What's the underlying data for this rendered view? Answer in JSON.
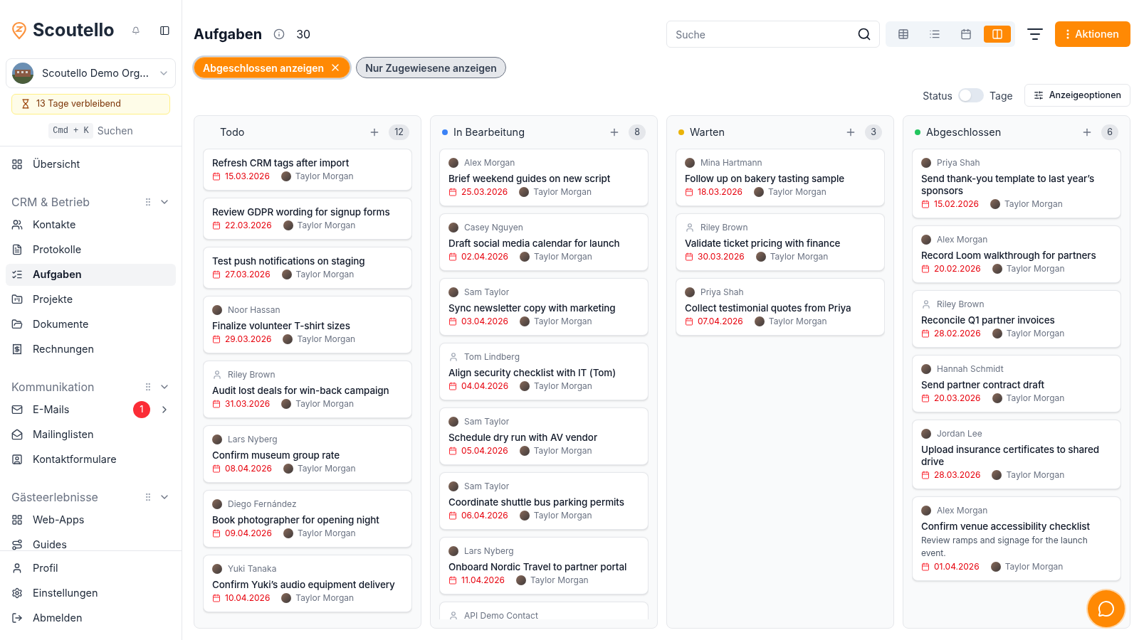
{
  "sidebar": {
    "brand": "Scoutello",
    "org": {
      "name": "Scoutello Demo Org..."
    },
    "trial": "13 Tage verbleibend",
    "shortcut": {
      "keys": "Cmd + K",
      "label": "Suchen"
    },
    "top_items": [
      {
        "label": "Übersicht",
        "selected": false
      }
    ],
    "sections": [
      {
        "title": "CRM & Betrieb",
        "items": [
          {
            "label": "Kontakte",
            "selected": false
          },
          {
            "label": "Protokolle",
            "selected": false
          },
          {
            "label": "Aufgaben",
            "selected": true
          },
          {
            "label": "Projekte",
            "selected": false
          },
          {
            "label": "Dokumente",
            "selected": false
          },
          {
            "label": "Rechnungen",
            "selected": false
          }
        ]
      },
      {
        "title": "Kommunikation",
        "items": [
          {
            "label": "E-Mails",
            "selected": false,
            "badge": "1"
          },
          {
            "label": "Mailinglisten",
            "selected": false
          },
          {
            "label": "Kontaktformulare",
            "selected": false
          }
        ]
      },
      {
        "title": "Gästeerlebnisse",
        "items": [
          {
            "label": "Web-Apps",
            "selected": false
          },
          {
            "label": "Guides",
            "selected": false
          }
        ]
      }
    ],
    "bottom_items": [
      {
        "label": "Profil"
      },
      {
        "label": "Einstellungen"
      },
      {
        "label": "Abmelden"
      }
    ]
  },
  "header": {
    "title": "Aufgaben",
    "count": "30",
    "search": {
      "placeholder": "Suche"
    },
    "views": [
      {
        "kind": "table",
        "selected": false
      },
      {
        "kind": "list",
        "selected": false
      },
      {
        "kind": "calendar",
        "selected": false
      },
      {
        "kind": "board",
        "selected": true
      }
    ],
    "actions_button": "Aktionen"
  },
  "filters": [
    {
      "label": "Abgeschlossen anzeigen",
      "selected": true
    },
    {
      "label": "Nur Zugewiesene anzeigen",
      "selected": false
    }
  ],
  "display": {
    "left_label": "Status",
    "right_label": "Tage",
    "on": false,
    "options_button": "Anzeigeoptionen"
  },
  "columns": [
    {
      "title": "Todo",
      "count": "12",
      "cards": [
        {
          "title": "Refresh CRM tags after import",
          "date": "15.03.2026",
          "assignee": "Taylor Morgan"
        },
        {
          "title": "Review GDPR wording for signup forms",
          "date": "22.03.2026",
          "assignee": "Taylor Morgan"
        },
        {
          "title": "Test push notifications on staging",
          "date": "27.03.2026",
          "assignee": "Taylor Morgan"
        },
        {
          "contact": {
            "name": "Noor Hassan"
          },
          "title": "Finalize volunteer T-shirt sizes",
          "date": "29.03.2026",
          "assignee": "Taylor Morgan"
        },
        {
          "contact": {
            "name": "Riley Brown",
            "kind": "generic"
          },
          "title": "Audit lost deals for win-back campaign",
          "date": "31.03.2026",
          "assignee": "Taylor Morgan"
        },
        {
          "contact": {
            "name": "Lars Nyberg"
          },
          "title": "Confirm museum group rate",
          "date": "08.04.2026",
          "assignee": "Taylor Morgan"
        },
        {
          "contact": {
            "name": "Diego Fernández"
          },
          "title": "Book photographer for opening night",
          "date": "09.04.2026",
          "assignee": "Taylor Morgan"
        },
        {
          "contact": {
            "name": "Yuki Tanaka"
          },
          "title": "Confirm Yuki’s audio equipment delivery",
          "date": "10.04.2026",
          "assignee": "Taylor Morgan"
        }
      ]
    },
    {
      "title": "In Bearbeitung",
      "color": "#3b82f6",
      "count": "8",
      "cards": [
        {
          "contact": {
            "name": "Alex Morgan"
          },
          "title": "Brief weekend guides on new script",
          "date": "25.03.2026",
          "assignee": "Taylor Morgan"
        },
        {
          "contact": {
            "name": "Casey Nguyen"
          },
          "title": "Draft social media calendar for launch",
          "date": "02.04.2026",
          "assignee": "Taylor Morgan"
        },
        {
          "contact": {
            "name": "Sam Taylor"
          },
          "title": "Sync newsletter copy with marketing",
          "date": "03.04.2026",
          "assignee": "Taylor Morgan"
        },
        {
          "contact": {
            "name": "Tom Lindberg",
            "kind": "generic"
          },
          "title": "Align security checklist with IT (Tom)",
          "date": "04.04.2026",
          "assignee": "Taylor Morgan"
        },
        {
          "contact": {
            "name": "Sam Taylor"
          },
          "title": "Schedule dry run with AV vendor",
          "date": "05.04.2026",
          "assignee": "Taylor Morgan"
        },
        {
          "contact": {
            "name": "Sam Taylor"
          },
          "title": "Coordinate shuttle bus parking permits",
          "date": "06.04.2026",
          "assignee": "Taylor Morgan"
        },
        {
          "contact": {
            "name": "Lars Nyberg"
          },
          "title": "Onboard Nordic Travel to partner portal",
          "date": "11.04.2026",
          "assignee": "Taylor Morgan"
        },
        {
          "contact": {
            "name": "API Demo Contact",
            "kind": "generic"
          }
        }
      ]
    },
    {
      "title": "Warten",
      "color": "#eab308",
      "count": "3",
      "cards": [
        {
          "contact": {
            "name": "Mina Hartmann"
          },
          "title": "Follow up on bakery tasting sample",
          "date": "18.03.2026",
          "assignee": "Taylor Morgan"
        },
        {
          "contact": {
            "name": "Riley Brown",
            "kind": "generic"
          },
          "title": "Validate ticket pricing with finance",
          "date": "30.03.2026",
          "assignee": "Taylor Morgan"
        },
        {
          "contact": {
            "name": "Priya Shah"
          },
          "title": "Collect testimonial quotes from Priya",
          "date": "07.04.2026",
          "assignee": "Taylor Morgan"
        }
      ]
    },
    {
      "title": "Abgeschlossen",
      "color": "#22c55e",
      "count": "6",
      "cards": [
        {
          "contact": {
            "name": "Priya Shah"
          },
          "title": "Send thank-you template to last year’s sponsors",
          "date": "15.02.2026",
          "assignee": "Taylor Morgan"
        },
        {
          "contact": {
            "name": "Alex Morgan"
          },
          "title": "Record Loom walkthrough for partners",
          "date": "20.02.2026",
          "assignee": "Taylor Morgan"
        },
        {
          "contact": {
            "name": "Riley Brown",
            "kind": "generic"
          },
          "title": "Reconcile Q1 partner invoices",
          "date": "28.02.2026",
          "assignee": "Taylor Morgan"
        },
        {
          "contact": {
            "name": "Hannah Schmidt"
          },
          "title": "Send partner contract draft",
          "date": "20.03.2026",
          "assignee": "Taylor Morgan"
        },
        {
          "contact": {
            "name": "Jordan Lee"
          },
          "title": "Upload insurance certificates to shared drive",
          "date": "28.03.2026",
          "assignee": "Taylor Morgan"
        },
        {
          "contact": {
            "name": "Alex Morgan"
          },
          "title": "Confirm venue accessibility checklist",
          "description": "Review ramps and signage for the launch event.",
          "date": "01.04.2026",
          "assignee": "Taylor Morgan"
        }
      ]
    }
  ]
}
